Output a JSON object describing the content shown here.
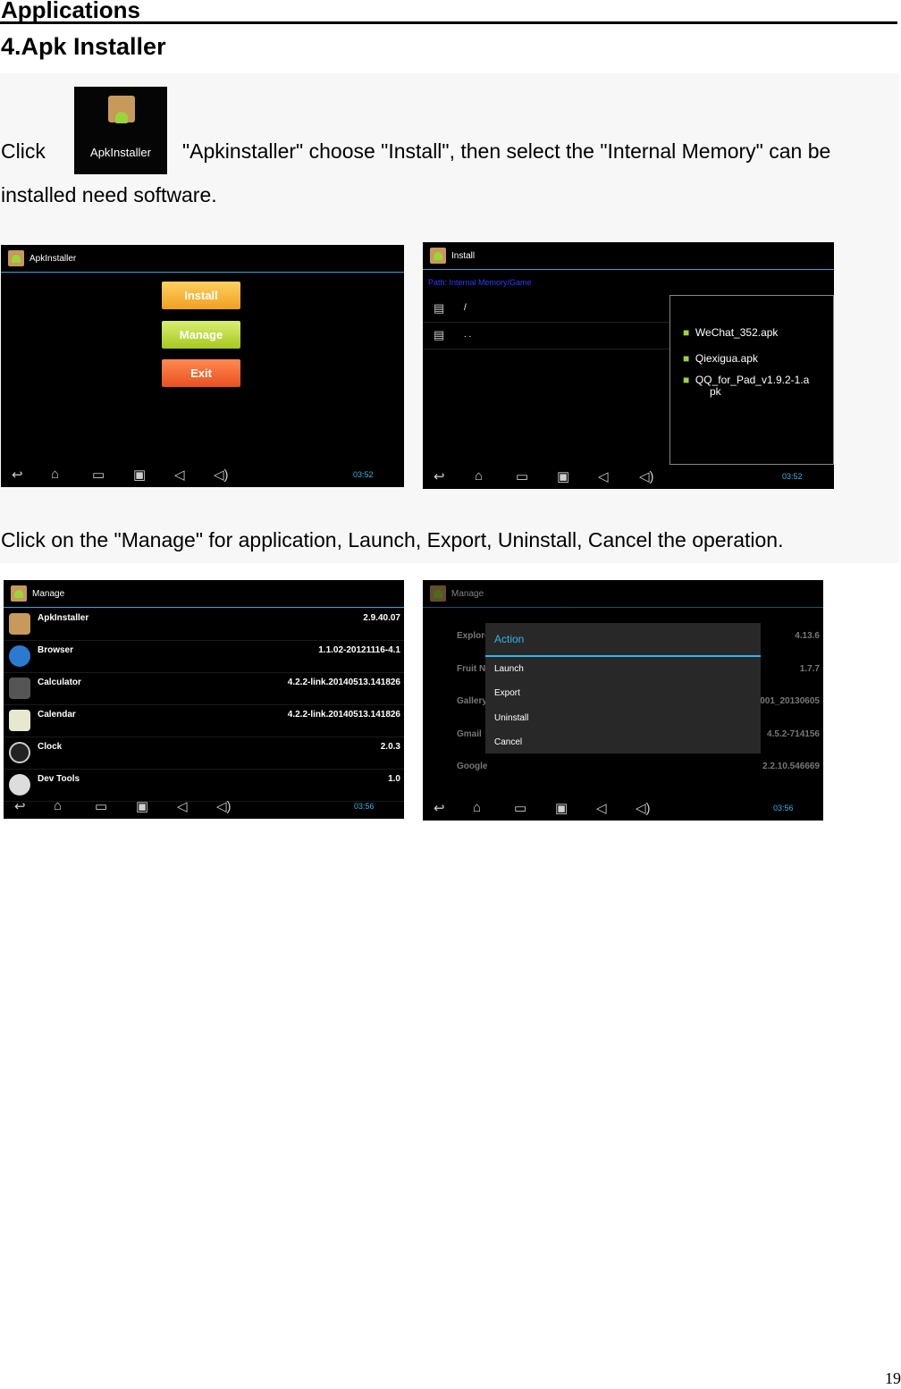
{
  "header": {
    "section": "Applications"
  },
  "title": "4.Apk Installer",
  "para1": {
    "before": "Click",
    "after": "\"Apkinstaller\" choose \"Install\", then select the \"Internal Memory\" can be",
    "cont": "installed need software."
  },
  "icon_label": "ApkInstaller",
  "para2": "Click on the \"Manage\" for application, Launch, Export, Uninstall, Cancel the operation.",
  "shot1": {
    "title": "ApkInstaller",
    "buttons": [
      "Install",
      "Manage",
      "Exit"
    ],
    "time": "03:52"
  },
  "shot2": {
    "title": "Install",
    "path": "Path: Internal Memory/Game",
    "dirs": [
      "/",
      ". ."
    ],
    "files": [
      "WeChat_352.apk",
      "Qiexigua.apk",
      "QQ_for_Pad_v1.9.2-1.a",
      "pk"
    ],
    "time": "03:52"
  },
  "shot3": {
    "title": "Manage",
    "apps": [
      {
        "name": "ApkInstaller",
        "version": "2.9.40.07"
      },
      {
        "name": "Browser",
        "version": "1.1.02-20121116-4.1"
      },
      {
        "name": "Calculator",
        "version": "4.2.2-link.20140513.141826"
      },
      {
        "name": "Calendar",
        "version": "4.2.2-link.20140513.141826"
      },
      {
        "name": "Clock",
        "version": "2.0.3"
      },
      {
        "name": "Dev Tools",
        "version": "1.0"
      }
    ],
    "time": "03:56"
  },
  "shot4": {
    "title": "Manage",
    "bg_apps": [
      {
        "name": "Explore",
        "version": "4.13.6"
      },
      {
        "name": "Fruit N",
        "version": "1.7.7"
      },
      {
        "name": "Gallery",
        "version": "001_20130605"
      },
      {
        "name": "Gmail",
        "version": "4.5.2-714156"
      },
      {
        "name": "Google",
        "version": "2.2.10.546669"
      }
    ],
    "dialog_title": "Action",
    "actions": [
      "Launch",
      "Export",
      "Uninstall",
      "Cancel"
    ],
    "time": "03:56"
  },
  "page_number": "19",
  "colors": {
    "accent": "#33b5e5",
    "install": "#f0a020",
    "manage": "#a8c820",
    "exit": "#e85020"
  }
}
